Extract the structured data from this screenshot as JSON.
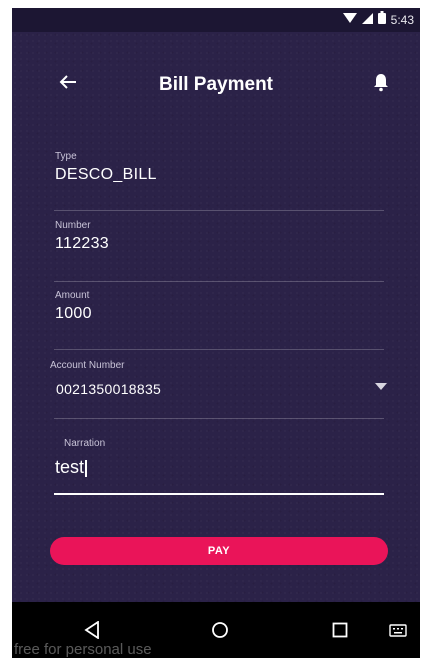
{
  "status_bar": {
    "time": "5:43"
  },
  "app_bar": {
    "title": "Bill Payment"
  },
  "form": {
    "type": {
      "label": "Type",
      "value": "DESCO_BILL"
    },
    "number": {
      "label": "Number",
      "value": "112233"
    },
    "amount": {
      "label": "Amount",
      "value": "1000"
    },
    "account_number": {
      "label": "Account Number",
      "value": "0021350018835"
    },
    "narration": {
      "label": "Narration",
      "value": "test"
    }
  },
  "pay_button": {
    "label": "PAY"
  },
  "watermark": "free for personal use",
  "colors": {
    "background": "#2b2248",
    "accent": "#ea1459"
  }
}
